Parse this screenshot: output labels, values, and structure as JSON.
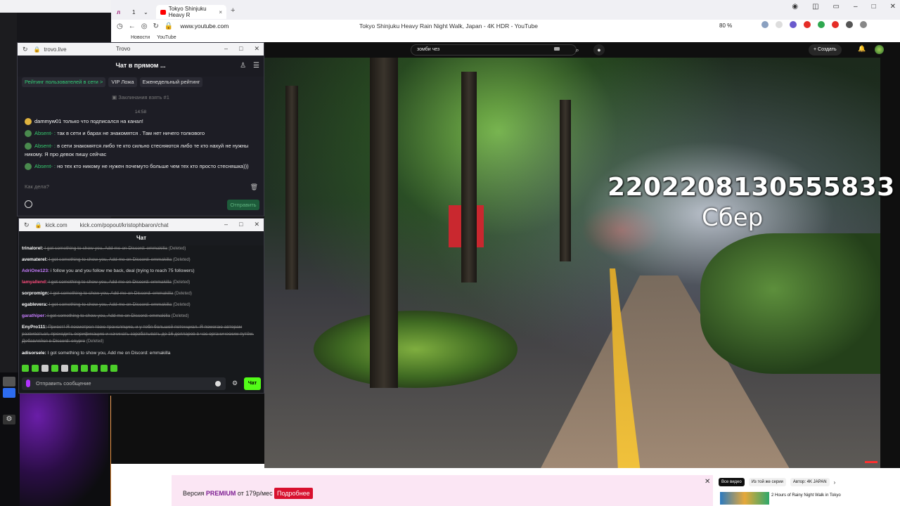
{
  "browser": {
    "tab_title": "Tokyo Shinjuku Heavy R",
    "tab_count": "1",
    "url": "www.youtube.com",
    "page_title": "Tokyo Shinjuku Heavy Rain Night Walk, Japan - 4K HDR - YouTube",
    "zoom": "80 %",
    "bookmarks": [
      "Новости",
      "YouTube"
    ]
  },
  "youtube": {
    "search_value": "зомби чез",
    "create_label": "+ Создать",
    "overlay_number": "2202208130555833",
    "overlay_label": "Сбер",
    "premium": {
      "text_prefix": "Версия ",
      "brand": "PREMIUM",
      "price": " от 179р/мес",
      "button": "Подробнее"
    },
    "chips": [
      "Все видео",
      "Из той же серии",
      "Автор: 4K JAPAN"
    ],
    "rec_title": "2 Hours of Rainy Night Walk in Tokyo"
  },
  "trovo": {
    "url": "trovo.live",
    "window_title": "Trovo",
    "chat_title": "Чат в прямом ...",
    "tabs": [
      "Рейтинг пользователей в сети >",
      "VIP Ложа",
      "Еженедельный рейтинг"
    ],
    "spell_text": "Заклинания взять #1",
    "time": "14:58",
    "messages": [
      {
        "nick": "dammyw01",
        "text": " только что подписался на канал!"
      },
      {
        "nick": "Absent- :",
        "text": " так в сети и барах не знакомятся . Там нет ничего толкового"
      },
      {
        "nick": "Absent- :",
        "text": " в сети знакомятся либо те кто сильно стесняются либо те кто нахуй не нужны никому. Я про девок пишу сейчас"
      },
      {
        "nick": "Absent- :",
        "text": " но тех кто никому не нужен почемуто больше чем тех кто просто стесняшка)))"
      }
    ],
    "input_placeholder": "Как дела?",
    "send_label": "Отправить"
  },
  "kick": {
    "url_short": "kick.com",
    "url_full": "kick.com/popout/kristophbaron/chat",
    "chat_title": "Чат",
    "messages": [
      {
        "nick": "trinalorel:",
        "text": " I got something to show you, Add me on Discord: emmakilla",
        "deleted": true,
        "tag": "(Deleted)",
        "color": "#ffffff"
      },
      {
        "nick": "avematerel:",
        "text": " I got something to show you, Add me on Discord: emmakilla",
        "deleted": true,
        "tag": "(Deleted)",
        "color": "#ffffff"
      },
      {
        "nick": "AdriOne123:",
        "text": " i follow you and you follow me back, deal (trying to reach 75 followers)",
        "deleted": false,
        "tag": "",
        "color": "#c77dff"
      },
      {
        "nick": "lamyallend:",
        "text": " I got something to show you, Add me on Discord: emmakilla",
        "deleted": true,
        "tag": "(Deleted)",
        "color": "#ff4d7d"
      },
      {
        "nick": "sorpromign:",
        "text": " I got something to show you, Add me on Discord: emmakilla",
        "deleted": true,
        "tag": "(Deleted)",
        "color": "#ffffff"
      },
      {
        "nick": "egablevera:",
        "text": " I got something to show you, Add me on Discord: emmakilla",
        "deleted": true,
        "tag": "(Deleted)",
        "color": "#ffffff"
      },
      {
        "nick": "garathiper:",
        "text": " I got something to show you, Add me on Discord: emmakilla",
        "deleted": true,
        "tag": "(Deleted)",
        "color": "#c77dff"
      },
      {
        "nick": "EnyPro111:",
        "text": " Привет! Я посмотрел твою трансляцию, и у тебя большой потенциал. Я помогаю авторам развиваться, проходить верификацию и начинать зарабатывать до 16 долларов в час органическим путём. Добавляйся в Discord: enypro",
        "deleted": true,
        "tag": "(Deleted)",
        "color": "#ffffff"
      },
      {
        "nick": "adisorsele:",
        "text": " I got something to show you, Add me on Discord: emmakilla",
        "deleted": false,
        "tag": "",
        "color": "#ffffff"
      }
    ],
    "input_placeholder": "Отправить сообщение",
    "send_label": "Чат"
  }
}
